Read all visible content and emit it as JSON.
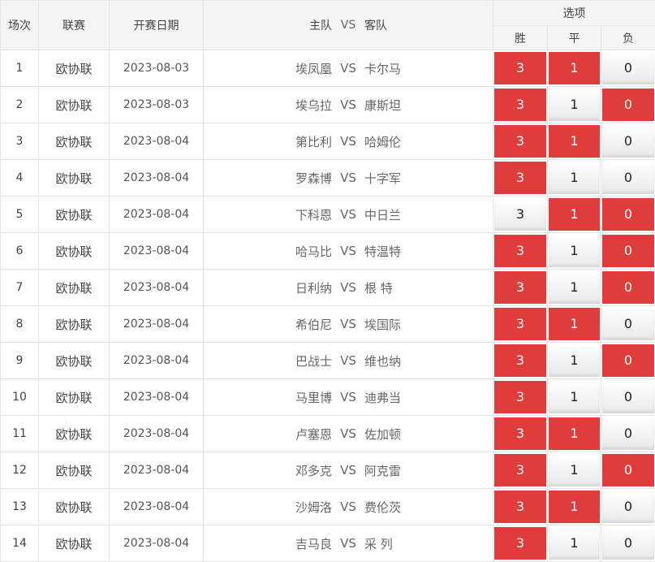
{
  "header": {
    "round": "场次",
    "league": "联赛",
    "date": "开赛日期",
    "home": "主队",
    "vs": "VS",
    "away": "客队",
    "options": "选项",
    "win": "胜",
    "draw": "平",
    "lose": "负"
  },
  "colors": {
    "selected": "#e03c3c",
    "unselected": "#f5f5f5"
  },
  "rows": [
    {
      "no": "1",
      "league": "欧协联",
      "date": "2023-08-03",
      "home": "埃凤凰",
      "vs": "VS",
      "away": "卡尔马",
      "win": "3",
      "draw": "1",
      "lose": "0",
      "sel": [
        true,
        true,
        false
      ]
    },
    {
      "no": "2",
      "league": "欧协联",
      "date": "2023-08-03",
      "home": "埃乌拉",
      "vs": "VS",
      "away": "康斯坦",
      "win": "3",
      "draw": "1",
      "lose": "0",
      "sel": [
        true,
        false,
        true
      ]
    },
    {
      "no": "3",
      "league": "欧协联",
      "date": "2023-08-04",
      "home": "第比利",
      "vs": "VS",
      "away": "哈姆伦",
      "win": "3",
      "draw": "1",
      "lose": "0",
      "sel": [
        true,
        true,
        false
      ]
    },
    {
      "no": "4",
      "league": "欧协联",
      "date": "2023-08-04",
      "home": "罗森博",
      "vs": "VS",
      "away": "十字军",
      "win": "3",
      "draw": "1",
      "lose": "0",
      "sel": [
        true,
        false,
        false
      ]
    },
    {
      "no": "5",
      "league": "欧协联",
      "date": "2023-08-04",
      "home": "下科恩",
      "vs": "VS",
      "away": "中日兰",
      "win": "3",
      "draw": "1",
      "lose": "0",
      "sel": [
        false,
        true,
        true
      ]
    },
    {
      "no": "6",
      "league": "欧协联",
      "date": "2023-08-04",
      "home": "哈马比",
      "vs": "VS",
      "away": "特温特",
      "win": "3",
      "draw": "1",
      "lose": "0",
      "sel": [
        true,
        false,
        true
      ]
    },
    {
      "no": "7",
      "league": "欧协联",
      "date": "2023-08-04",
      "home": "日利纳",
      "vs": "VS",
      "away": "根 特",
      "win": "3",
      "draw": "1",
      "lose": "0",
      "sel": [
        true,
        false,
        true
      ]
    },
    {
      "no": "8",
      "league": "欧协联",
      "date": "2023-08-04",
      "home": "希伯尼",
      "vs": "VS",
      "away": "埃国际",
      "win": "3",
      "draw": "1",
      "lose": "0",
      "sel": [
        true,
        true,
        false
      ]
    },
    {
      "no": "9",
      "league": "欧协联",
      "date": "2023-08-04",
      "home": "巴战士",
      "vs": "VS",
      "away": "维也纳",
      "win": "3",
      "draw": "1",
      "lose": "0",
      "sel": [
        true,
        false,
        true
      ]
    },
    {
      "no": "10",
      "league": "欧协联",
      "date": "2023-08-04",
      "home": "马里博",
      "vs": "VS",
      "away": "迪弗当",
      "win": "3",
      "draw": "1",
      "lose": "0",
      "sel": [
        true,
        false,
        false
      ]
    },
    {
      "no": "11",
      "league": "欧协联",
      "date": "2023-08-04",
      "home": "卢塞恩",
      "vs": "VS",
      "away": "佐加顿",
      "win": "3",
      "draw": "1",
      "lose": "0",
      "sel": [
        true,
        true,
        false
      ]
    },
    {
      "no": "12",
      "league": "欧协联",
      "date": "2023-08-04",
      "home": "邓多克",
      "vs": "VS",
      "away": "阿克雷",
      "win": "3",
      "draw": "1",
      "lose": "0",
      "sel": [
        true,
        false,
        true
      ]
    },
    {
      "no": "13",
      "league": "欧协联",
      "date": "2023-08-04",
      "home": "沙姆洛",
      "vs": "VS",
      "away": "费伦茨",
      "win": "3",
      "draw": "1",
      "lose": "0",
      "sel": [
        true,
        true,
        false
      ]
    },
    {
      "no": "14",
      "league": "欧协联",
      "date": "2023-08-04",
      "home": "吉马良",
      "vs": "VS",
      "away": "采 列",
      "win": "3",
      "draw": "1",
      "lose": "0",
      "sel": [
        true,
        false,
        false
      ]
    }
  ]
}
